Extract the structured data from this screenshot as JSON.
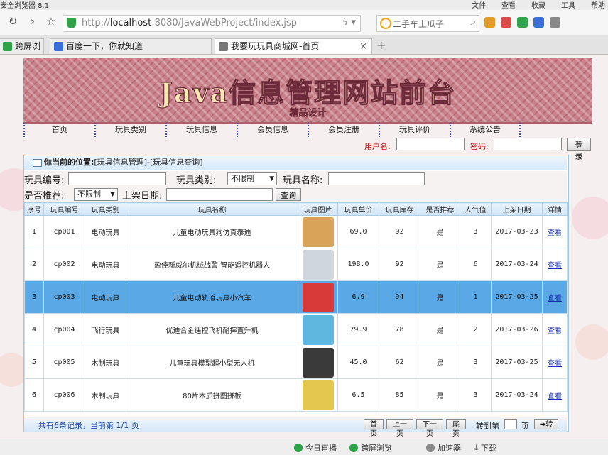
{
  "browser": {
    "app_title": "安全浏览器 8.1",
    "menus": [
      "文件",
      "查看",
      "收藏",
      "工具",
      "帮助"
    ],
    "url_prefix": "http://",
    "url_host": "localhost",
    "url_rest": ":8080/JavaWebProject/index.jsp",
    "search_placeholder": "二手车上瓜子",
    "tabs": [
      {
        "label": "跨屏浏览",
        "icon_color": "#2ea34a"
      },
      {
        "label": "百度一下，你就知道",
        "icon_color": "#3b6fd8"
      },
      {
        "label": "我要玩玩具商城网-首页",
        "icon_color": "#777777",
        "active": true
      }
    ]
  },
  "site": {
    "banner_title": "Java信息管理网站前台",
    "banner_subtitle": "精品设计",
    "nav": [
      "首页",
      "玩具类别",
      "玩具信息",
      "会员信息",
      "会员注册",
      "玩具评价",
      "系统公告"
    ],
    "login": {
      "username_label": "用户名:",
      "password_label": "密码:",
      "login_button": "登录"
    }
  },
  "panel": {
    "location_label": "你当前的位置:",
    "location_path": "[玩具信息管理]-[玩具信息查询]",
    "filters": {
      "toy_no_label": "玩具编号:",
      "toy_type_label": "玩具类别:",
      "toy_type_value": "不限制",
      "toy_name_label": "玩具名称:",
      "recommend_label": "是否推荐:",
      "recommend_value": "不限制",
      "date_label": "上架日期:",
      "query_button": "查询"
    },
    "columns": [
      "序号",
      "玩具编号",
      "玩具类别",
      "玩具名称",
      "玩具图片",
      "玩具单价",
      "玩具库存",
      "是否推荐",
      "人气值",
      "上架日期",
      "详情"
    ],
    "rows": [
      {
        "index": "1",
        "code": "cp001",
        "category": "电动玩具",
        "name": "儿童电动玩具狗仿真泰迪",
        "price": "69.0",
        "stock": "92",
        "recommend": "是",
        "popularity": "3",
        "date": "2017-03-23",
        "detail": "查看",
        "thumb_color": "#d9a35a"
      },
      {
        "index": "2",
        "code": "cp002",
        "category": "电动玩具",
        "name": "盈佳新威尔机械战警 智能遥控机器人",
        "price": "198.0",
        "stock": "92",
        "recommend": "是",
        "popularity": "6",
        "date": "2017-03-24",
        "detail": "查看",
        "thumb_color": "#cfd6dc"
      },
      {
        "index": "3",
        "code": "cp003",
        "category": "电动玩具",
        "name": "儿童电动轨道玩具小汽车",
        "price": "6.9",
        "stock": "94",
        "recommend": "是",
        "popularity": "1",
        "date": "2017-03-25",
        "detail": "查看",
        "thumb_color": "#d83a3a",
        "selected": true
      },
      {
        "index": "4",
        "code": "cp004",
        "category": "飞行玩具",
        "name": "优迪合金遥控飞机耐摔直升机",
        "price": "79.9",
        "stock": "78",
        "recommend": "是",
        "popularity": "2",
        "date": "2017-03-26",
        "detail": "查看",
        "thumb_color": "#5fb7e0"
      },
      {
        "index": "5",
        "code": "cp005",
        "category": "木制玩具",
        "name": "儿童玩具模型超小型无人机",
        "price": "45.0",
        "stock": "62",
        "recommend": "是",
        "popularity": "3",
        "date": "2017-03-25",
        "detail": "查看",
        "thumb_color": "#3a3a3a"
      },
      {
        "index": "6",
        "code": "cp006",
        "category": "木制玩具",
        "name": "80片木质拼图拼板",
        "price": "6.5",
        "stock": "85",
        "recommend": "是",
        "popularity": "3",
        "date": "2017-03-24",
        "detail": "查看",
        "thumb_color": "#e3c74e"
      }
    ],
    "footer": {
      "info": "共有6条记录，当前第 1/1 页",
      "first": "首页",
      "prev": "上一页",
      "next": "下一页",
      "last": "尾页",
      "goto_label": "转到第",
      "page_label": "页",
      "go_button": "转"
    }
  },
  "statusbar": {
    "items": [
      "今日直播",
      "跨屏浏览",
      "加速器",
      "下载"
    ]
  }
}
